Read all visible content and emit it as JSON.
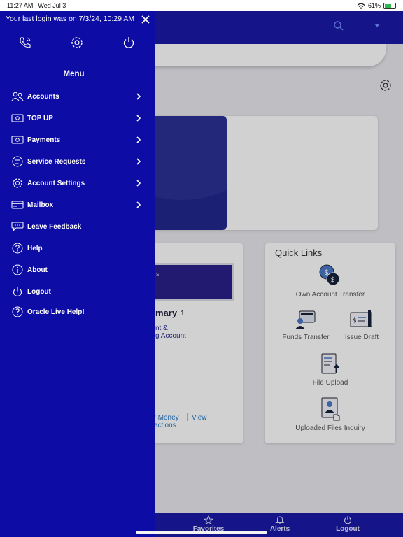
{
  "status_bar": {
    "time": "11:27 AM",
    "date": "Wed Jul 3",
    "battery": "61%",
    "battery_level": 0.61
  },
  "drawer": {
    "login_message": "Your last login was on 7/3/24, 10:29 AM",
    "close_icon": "close-icon",
    "quick_actions": [
      "phone-icon",
      "gear-icon",
      "power-icon"
    ],
    "menu_title": "Menu",
    "items": [
      {
        "label": "Accounts",
        "icon": "users-icon",
        "has_chevron": true
      },
      {
        "label": "TOP UP",
        "icon": "cash-icon",
        "has_chevron": true
      },
      {
        "label": "Payments",
        "icon": "cash-icon",
        "has_chevron": true
      },
      {
        "label": "Service Requests",
        "icon": "list-icon",
        "has_chevron": true
      },
      {
        "label": "Account Settings",
        "icon": "gear-icon",
        "has_chevron": true
      },
      {
        "label": "Mailbox",
        "icon": "card-icon",
        "has_chevron": true
      },
      {
        "label": "Leave Feedback",
        "icon": "chat-icon",
        "has_chevron": false
      },
      {
        "label": "Help",
        "icon": "question-icon",
        "has_chevron": false
      },
      {
        "label": "About",
        "icon": "info-icon",
        "has_chevron": false
      },
      {
        "label": "Logout",
        "icon": "power-icon",
        "has_chevron": false
      },
      {
        "label": "Oracle Live Help!",
        "icon": "question-icon",
        "has_chevron": false
      }
    ]
  },
  "summary": {
    "banner_line1": "s",
    "title": "mary",
    "count": "1",
    "line1": "nt &",
    "line2": "g Account",
    "link_transfer": "er Money",
    "link_transfer2": "actions",
    "link_view": "View"
  },
  "quick_links": {
    "title": "Quick Links",
    "items": [
      {
        "label": "Own Account Transfer",
        "icon": "dollar-transfer-icon"
      },
      {
        "label": "Funds Transfer",
        "icon": "wallet-person-icon"
      },
      {
        "label": "Issue Draft",
        "icon": "draft-check-icon"
      },
      {
        "label": "File Upload",
        "icon": "file-upload-icon"
      },
      {
        "label": "Uploaded Files Inquiry",
        "icon": "files-inquiry-icon"
      }
    ]
  },
  "bottom_nav": [
    {
      "label": "Favorites",
      "icon": "star-icon"
    },
    {
      "label": "Alerts",
      "icon": "bell-icon"
    },
    {
      "label": "Logout",
      "icon": "power-icon"
    }
  ],
  "colors": {
    "drawer": "#0d0da5",
    "header": "#1a1aa8",
    "link": "#2a7cc7"
  }
}
